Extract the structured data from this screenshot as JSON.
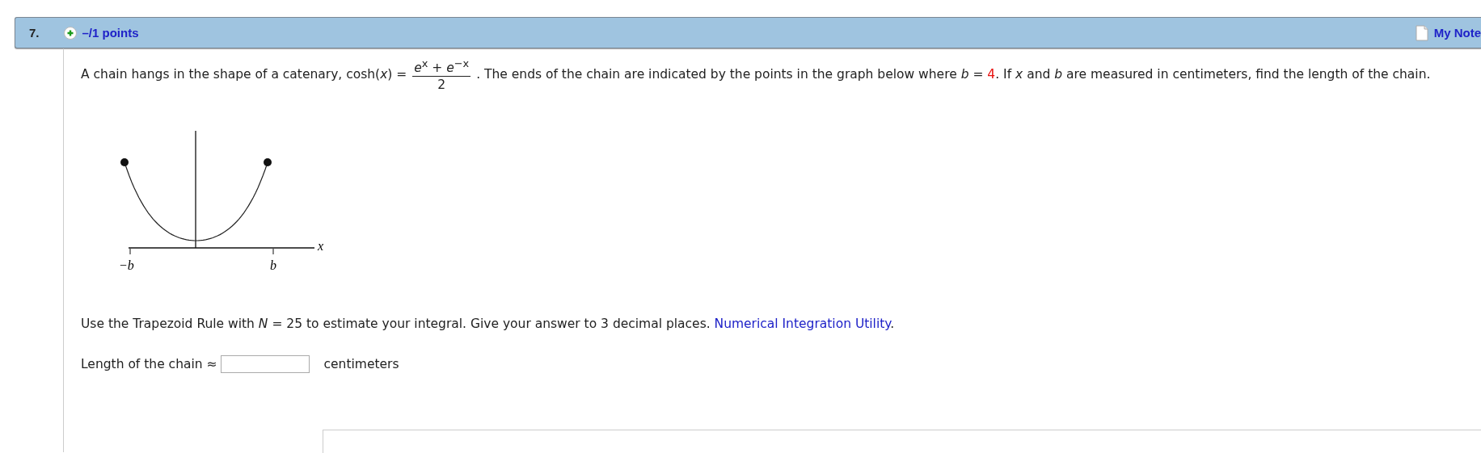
{
  "question": {
    "number": "7.",
    "points": "–/1 points",
    "notes_link": "My Note"
  },
  "paragraph": [
    {
      "kind": "text",
      "text": "A chain hangs in the shape of a catenary,  cosh(*x*) = "
    },
    {
      "kind": "fraction",
      "numerator": "*e*$^{x}$ + *e*$^{−x}$",
      "denominator": "2"
    },
    {
      "kind": "text",
      "text": " . The ends of the chain are indicated by the points in the graph below where *b* = "
    },
    {
      "kind": "given",
      "text": "4"
    },
    {
      "kind": "text",
      "text": ". If *x* and *b* are measured in centimeters, find the length of the chain."
    }
  ],
  "graph": {
    "x_axis_label": "x",
    "left_tick": "−b",
    "right_tick": "b"
  },
  "instruction": {
    "text": "Use the Trapezoid Rule with *N* = 25 to estimate your integral. Give your answer to 3 decimal places. ",
    "link": "Numerical Integration Utility",
    "after": "."
  },
  "answer": {
    "label": "Length of the chain ≈",
    "unit": "centimeters"
  }
}
